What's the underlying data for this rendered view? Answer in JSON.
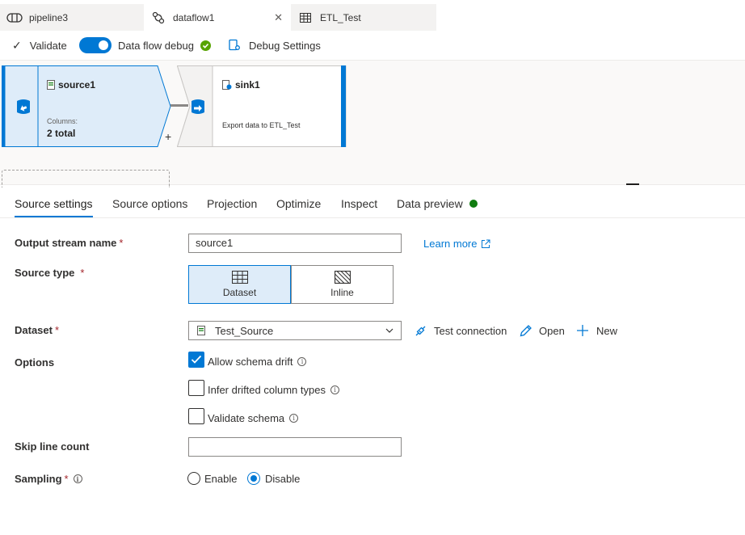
{
  "tabs": [
    {
      "label": "pipeline3",
      "icon": "pipeline-icon"
    },
    {
      "label": "dataflow1",
      "icon": "dataflow-icon",
      "active": true
    },
    {
      "label": "ETL_Test",
      "icon": "table-icon"
    }
  ],
  "toolbar": {
    "validate_label": "Validate",
    "debug_label": "Data flow debug",
    "debug_settings_label": "Debug Settings"
  },
  "canvas": {
    "source": {
      "name": "source1",
      "columns_label": "Columns:",
      "columns_value": "2 total"
    },
    "sink": {
      "name": "sink1",
      "description": "Export data to ETL_Test"
    },
    "add_symbol": "+"
  },
  "settings_tabs": [
    {
      "label": "Source settings",
      "active": true
    },
    {
      "label": "Source options"
    },
    {
      "label": "Projection"
    },
    {
      "label": "Optimize"
    },
    {
      "label": "Inspect"
    },
    {
      "label": "Data preview",
      "status": "green-dot"
    }
  ],
  "form": {
    "output_stream": {
      "label": "Output stream name",
      "required": "*",
      "value": "source1",
      "learn_more": "Learn more"
    },
    "source_type": {
      "label": "Source type",
      "required": "*",
      "options": [
        "Dataset",
        "Inline"
      ],
      "selected": "Dataset"
    },
    "dataset": {
      "label": "Dataset",
      "required": "*",
      "value": "Test_Source",
      "test_connection": "Test connection",
      "open": "Open",
      "new": "New"
    },
    "options": {
      "label": "Options",
      "allow_schema_drift": "Allow schema drift",
      "infer_drifted": "Infer drifted column types",
      "validate_schema": "Validate schema"
    },
    "skip_line_count": {
      "label": "Skip line count",
      "value": ""
    },
    "sampling": {
      "label": "Sampling",
      "required": "*",
      "enable": "Enable",
      "disable": "Disable",
      "selected": "Disable"
    }
  },
  "colors": {
    "accent": "#0078d4",
    "success": "#57a300",
    "required": "#a4262c"
  }
}
